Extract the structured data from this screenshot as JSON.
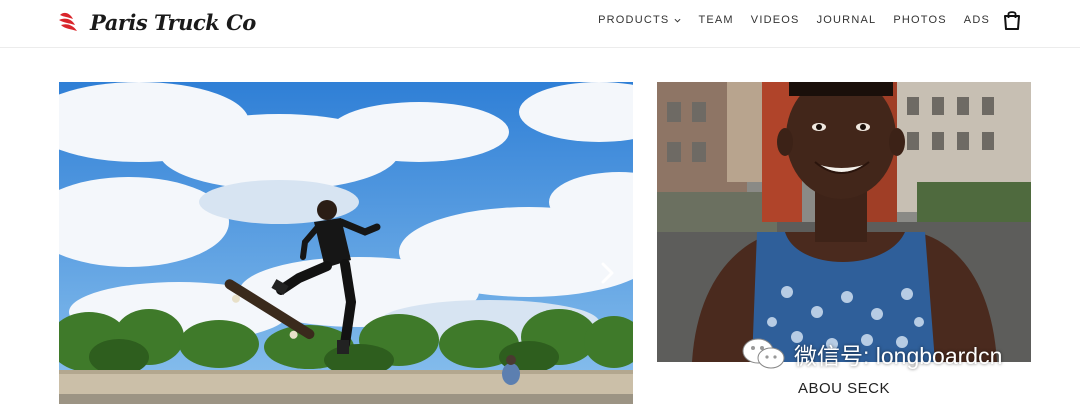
{
  "brand": {
    "name": "Paris Truck Co",
    "accent_color": "#d9252b"
  },
  "nav": {
    "items": [
      {
        "label": "PRODUCTS",
        "has_dropdown": true
      },
      {
        "label": "TEAM"
      },
      {
        "label": "VIDEOS"
      },
      {
        "label": "JOURNAL"
      },
      {
        "label": "PHOTOS"
      },
      {
        "label": "ADS"
      }
    ],
    "cart_icon": "shopping-bag-icon"
  },
  "hero": {
    "image": "skateboarder-jumping-sky-photo",
    "next_icon": "chevron-right-icon"
  },
  "profile": {
    "image": "rider-portrait-photo",
    "name": "ABOU SECK"
  },
  "watermark": {
    "text": "微信号: longboardcn",
    "icon": "wechat-icon"
  }
}
